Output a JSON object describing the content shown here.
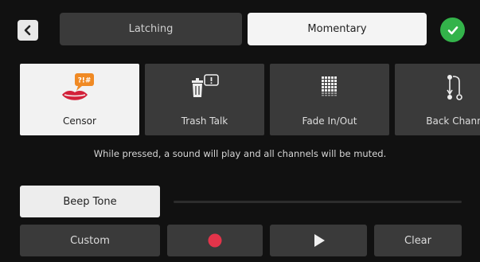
{
  "mode": {
    "latching_label": "Latching",
    "momentary_label": "Momentary",
    "selected": "Momentary"
  },
  "effects": [
    {
      "label": "Censor",
      "icon": "censor-lips-icon",
      "selected": true
    },
    {
      "label": "Trash Talk",
      "icon": "trash-talk-icon",
      "selected": false
    },
    {
      "label": "Fade In/Out",
      "icon": "fade-grid-icon",
      "selected": false
    },
    {
      "label": "Back Chann",
      "icon": "back-channel-icon",
      "selected": false
    }
  ],
  "description": "While pressed, a sound will play and all channels will be muted.",
  "sound": {
    "name": "Beep Tone"
  },
  "controls": {
    "custom_label": "Custom",
    "clear_label": "Clear"
  },
  "colors": {
    "accent_green": "#33b34a",
    "record_red": "#e3344a",
    "censor_red": "#d3213a",
    "bubble_orange": "#f08a24"
  }
}
